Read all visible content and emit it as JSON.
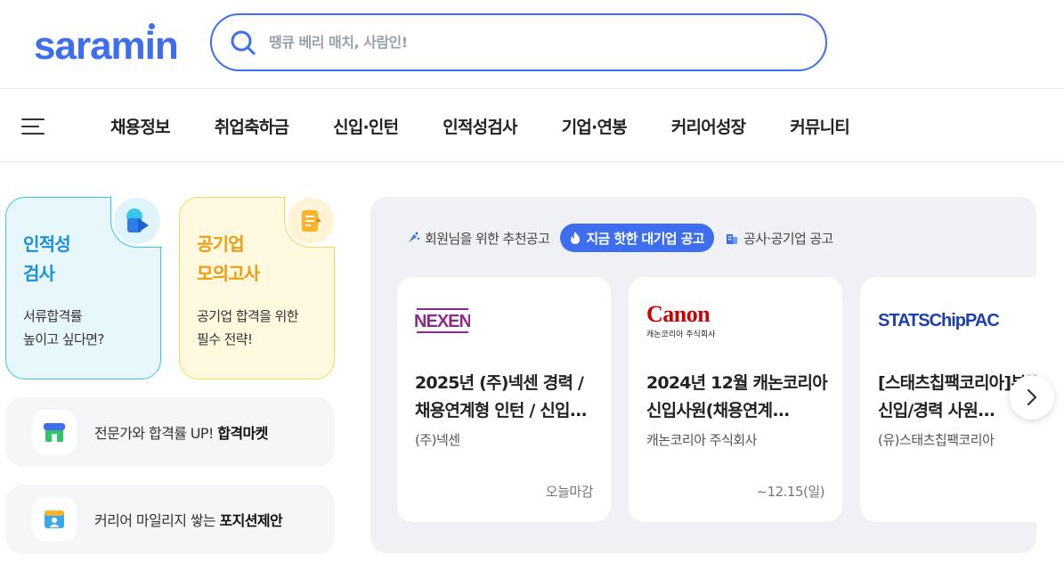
{
  "header": {
    "logo": "saramin",
    "search_placeholder": "땡큐 베리 매치, 사람인!"
  },
  "nav": {
    "items": [
      "채용정보",
      "취업축하금",
      "신입·인턴",
      "인적성검사",
      "기업·연봉",
      "커리어성장",
      "커뮤니티"
    ]
  },
  "left": {
    "test_card": {
      "title": "인적성\n검사",
      "desc": "서류합격률\n높이고 싶다면?"
    },
    "exam_card": {
      "title": "공기업\n모의고사",
      "desc": "공기업 합격을 위한\n필수 전략!"
    },
    "market": {
      "prefix": "전문가와 합격률 UP! ",
      "bold": "합격마켓"
    },
    "position": {
      "prefix": "커리어 마일리지 쌓는 ",
      "bold": "포지션제안"
    }
  },
  "panel": {
    "tabs": [
      {
        "label": "회원님을 위한 추천공고",
        "icon": "sparkle-icon",
        "active": false
      },
      {
        "label": "지금 핫한 대기업 공고",
        "icon": "fire-icon",
        "active": true
      },
      {
        "label": "공사·공기업 공고",
        "icon": "building-icon",
        "active": false
      }
    ],
    "jobs": [
      {
        "logo": "NEXEN",
        "title": "2025년 (주)넥센 경력 / 채용연계형 인턴 / 신입...",
        "company": "(주)넥센",
        "deadline": "오늘마감"
      },
      {
        "logo": "Canon",
        "logo_sub": "캐논코리아 주식회사",
        "title": "2024년 12월 캐논코리아 신입사원(채용연계...",
        "company": "캐논코리아 주식회사",
        "deadline": "~12.15(일)"
      },
      {
        "logo": "STATSChipPAC",
        "title": "[스태츠칩팩코리아]부문 신입/경력 사원...",
        "company": "(유)스태츠칩팩코리아",
        "deadline": ""
      }
    ]
  },
  "colors": {
    "brand": "#3d6ef0",
    "test_accent": "#1b8fd8",
    "exam_accent": "#f19a12"
  }
}
